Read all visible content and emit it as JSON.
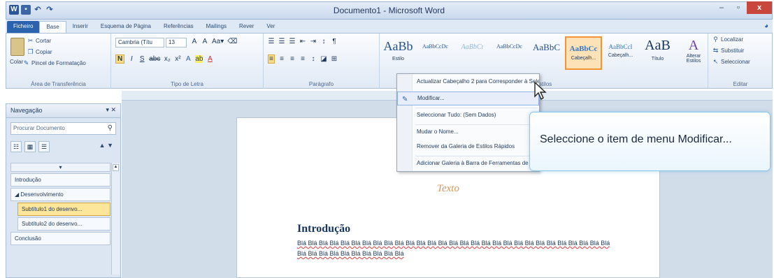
{
  "window": {
    "title": "Documento1 - Microsoft Word",
    "app_icon": "word-icon",
    "minimize": "–",
    "restore": "▫",
    "close": "x"
  },
  "tabs": [
    {
      "label": "Ficheiro"
    },
    {
      "label": "Base"
    },
    {
      "label": "Inserir"
    },
    {
      "label": "Esquema de Página"
    },
    {
      "label": "Referências"
    },
    {
      "label": "Mailings"
    },
    {
      "label": "Rever"
    },
    {
      "label": "Ver"
    }
  ],
  "ribbon": {
    "clipboard": {
      "label": "Área de Transferência",
      "paste": "Colar",
      "cut": "Cortar",
      "copy": "Copiar",
      "format_painter": "Pincel de Formatação"
    },
    "font": {
      "label": "Tipo de Letra",
      "font_name": "Cambria (Títu",
      "font_size": "13",
      "row1": [
        "A",
        "A",
        "Aa▾",
        "⌫"
      ],
      "row2": [
        "N",
        "I",
        "S",
        "abc",
        "x₂",
        "x²",
        "A",
        "ab",
        "A"
      ]
    },
    "paragraph": {
      "label": "Parágrafo",
      "row1": [
        "☰",
        "☰",
        "☰",
        "⇤",
        "⇥",
        "↕",
        "¶"
      ],
      "row2": [
        "≡",
        "≡",
        "≡",
        "≡",
        "↕",
        "◪",
        "⊞"
      ]
    },
    "styles": {
      "label": "Estilos",
      "tiles": [
        {
          "sample": "AaBb",
          "name": "Estilo"
        },
        {
          "sample": "AaBbCcDc",
          "name": ""
        },
        {
          "sample": "AaBbCı",
          "name": ""
        },
        {
          "sample": "AaBbCcDc",
          "name": ""
        },
        {
          "sample": "AaBbC",
          "name": ""
        },
        {
          "sample": "AaBbCc",
          "name": "Cabeçalh..."
        },
        {
          "sample": "AaBbCcI",
          "name": "Cabeçalh..."
        },
        {
          "sample": "AaB",
          "name": "Título"
        }
      ],
      "change_styles": "Alterar Estilos"
    },
    "editing": {
      "label": "Editar",
      "find": "Localizar",
      "replace": "Substituir",
      "select": "Seleccionar"
    }
  },
  "navigation": {
    "title": "Navegação",
    "search_placeholder": "Procurar Documento",
    "collapse": "▾",
    "items": [
      {
        "label": "Introdução",
        "level": 0,
        "highlighted": false
      },
      {
        "label": "◢ Desenvolvimento",
        "level": 0,
        "highlighted": false
      },
      {
        "label": "Subtítulo1 do desenvo...",
        "level": 1,
        "highlighted": true
      },
      {
        "label": "Subtítulo2 do desenvo...",
        "level": 1,
        "highlighted": false
      },
      {
        "label": "Conclusão",
        "level": 0,
        "highlighted": false
      }
    ]
  },
  "document": {
    "texto": "Texto",
    "heading": "Introdução",
    "body": "Blá Blá Blá Blá Blá Blá Blá Blá Blá Blá Blá Blá Blá Blá Blá Blá Blá Blá Blá Blá Blá Blá Blá Blá Blá Blá Blá Blá Blá Blá Blá Blá Blá Blá Blá Blá Blá Blá Blá"
  },
  "context_menu": {
    "items": [
      {
        "label": "Actualizar Cabeçalho 2 para Corresponder à Selecção"
      },
      {
        "label": "Modificar..."
      },
      {
        "label": "Seleccionar Tudo: (Sem Dados)"
      },
      {
        "label": "Mudar o Nome..."
      },
      {
        "label": "Remover da Galeria de Estilos Rápidos"
      },
      {
        "label": "Adicionar Galeria à Barra de Ferramentas de Acesso Rápido"
      }
    ]
  },
  "callout": {
    "text": "Seleccione o item de menu Modificar..."
  },
  "colors": {
    "accent": "#2a62ad",
    "highlight": "#fde59a",
    "callout_border": "#8ac6ea",
    "close": "#c9463d"
  }
}
